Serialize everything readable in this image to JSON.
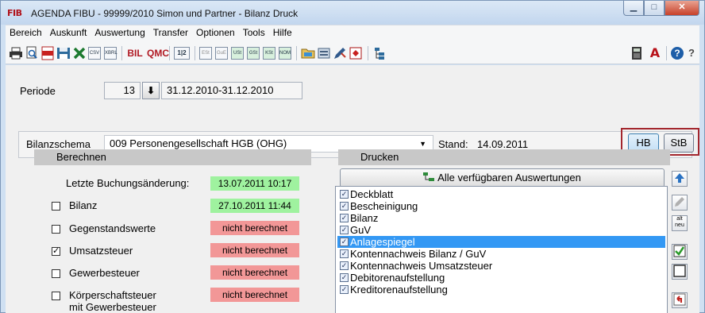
{
  "window": {
    "app_icon": "FIB",
    "title": "AGENDA FIBU - 99999/2010 Simon und Partner - Bilanz Druck",
    "buttons": {
      "minimize": "▁",
      "maximize": "□",
      "close": "✕"
    }
  },
  "menu": [
    "Bereich",
    "Auskunft",
    "Auswertung",
    "Transfer",
    "Optionen",
    "Tools",
    "Hilfe"
  ],
  "toolbar": {
    "icons": [
      "printer-icon",
      "preview-icon",
      "pdf-icon",
      "save-icon",
      "excel-icon",
      "csv-icon",
      "xbrl-icon",
      "bil-icon",
      "qmc-icon",
      "page-range-icon",
      "est-icon",
      "gue-icon",
      "ust-icon",
      "gst-icon",
      "kst-icon",
      "nom-icon",
      "folder-icon",
      "db-icon",
      "pen-icon",
      "pdf-stamp-icon",
      "tree-icon",
      "calculator-icon",
      "agenda-icon",
      "help-icon",
      "what-is-this-icon"
    ],
    "labels": {
      "csv": "CSV",
      "xbrl": "XBRL",
      "bil": "BIL",
      "qmc": "QMC",
      "page": "1|2",
      "est": "ESt",
      "gue": "GuE",
      "ust": "USt",
      "gst": "GSt",
      "kst": "KSt",
      "nom": "NOM",
      "agenda": "A",
      "help": "?",
      "whatis": "?"
    }
  },
  "periode": {
    "label": "Periode",
    "value": "13",
    "range": "31.12.2010-31.12.2010"
  },
  "bilanzschema": {
    "label": "Bilanzschema",
    "value": "009 Personengesellschaft HGB (OHG)",
    "stand_label": "Stand:",
    "stand_value": "14.09.2011",
    "hb_label": "HB",
    "stb_label": "StB"
  },
  "berechnen": {
    "title": "Berechnen",
    "letzte_label": "Letzte Buchungsänderung:",
    "letzte_value": "13.07.2011 10:17",
    "items": [
      {
        "label": "Bilanz",
        "checked": false,
        "status": "27.10.2011 11:44",
        "status_type": "green"
      },
      {
        "label": "Gegenstandswerte",
        "checked": false,
        "status": "nicht berechnet",
        "status_type": "red"
      },
      {
        "label": "Umsatzsteuer",
        "checked": true,
        "status": "nicht berechnet",
        "status_type": "red"
      },
      {
        "label": "Gewerbesteuer",
        "checked": false,
        "status": "nicht berechnet",
        "status_type": "red"
      },
      {
        "label": "Körperschaftsteuer",
        "label2": "mit Gewerbesteuer",
        "checked": false,
        "status": "nicht berechnet",
        "status_type": "red"
      }
    ],
    "colors": {
      "green": "#9ff29f",
      "red": "#f29797"
    }
  },
  "drucken": {
    "title": "Drucken",
    "alle_button": "Alle verfügbaren Auswertungen",
    "items": [
      {
        "label": "Deckblatt",
        "checked": true,
        "selected": false
      },
      {
        "label": "Bescheinigung",
        "checked": true,
        "selected": false
      },
      {
        "label": "Bilanz",
        "checked": true,
        "selected": false
      },
      {
        "label": "GuV",
        "checked": true,
        "selected": false
      },
      {
        "label": "Anlagespiegel",
        "checked": true,
        "selected": true
      },
      {
        "label": "Kontennachweis Bilanz / GuV",
        "checked": true,
        "selected": false
      },
      {
        "label": "Kontennachweis Umsatzsteuer",
        "checked": true,
        "selected": false
      },
      {
        "label": "Debitorenaufstellung",
        "checked": true,
        "selected": false
      },
      {
        "label": "Kreditorenaufstellung",
        "checked": true,
        "selected": false
      }
    ],
    "side_buttons": [
      "move-top-icon",
      "edit-icon",
      "alt-neu-icon",
      "check-all-icon",
      "uncheck-all-icon",
      "reset-icon"
    ],
    "side_labels": {
      "alt_neu": "alt neu"
    }
  }
}
